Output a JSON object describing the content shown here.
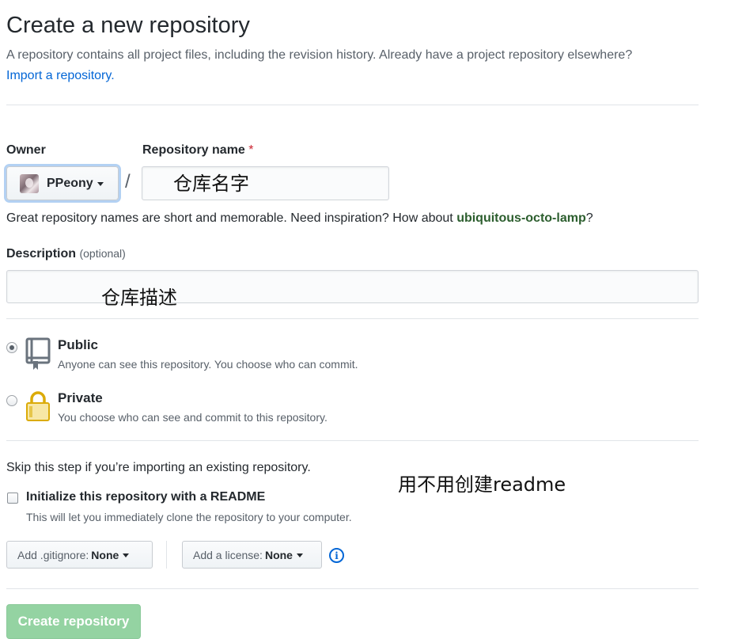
{
  "header": {
    "title": "Create a new repository",
    "subtitle": "A repository contains all project files, including the revision history. Already have a project repository elsewhere?",
    "import_link": "Import a repository."
  },
  "form": {
    "owner_label": "Owner",
    "owner_name": "PPeony",
    "slash": "/",
    "repo_name_label": "Repository name",
    "required_mark": "*",
    "repo_name_annotation": "仓库名字",
    "name_hint_prefix": "Great repository names are short and memorable. Need inspiration? How about ",
    "name_suggestion": "ubiquitous-octo-lamp",
    "name_hint_suffix": "?",
    "description_label": "Description",
    "description_optional": "(optional)",
    "description_annotation": "仓库描述"
  },
  "visibility": {
    "public": {
      "title": "Public",
      "description": "Anyone can see this repository. You choose who can commit.",
      "selected": true
    },
    "private": {
      "title": "Private",
      "description": "You choose who can see and commit to this repository.",
      "selected": false
    }
  },
  "init": {
    "skip_text": "Skip this step if you’re importing an existing repository.",
    "readme_annotation": "用不用创建readme",
    "readme_label": "Initialize this repository with a README",
    "readme_hint": "This will let you immediately clone the repository to your computer.",
    "readme_checked": false,
    "gitignore_label": "Add .gitignore:",
    "gitignore_value": "None",
    "license_label": "Add a license:",
    "license_value": "None",
    "info_glyph": "i"
  },
  "submit": {
    "create_label": "Create repository"
  },
  "icons": {
    "repo": "repo-book-icon",
    "lock": "lock-icon",
    "info": "info-icon",
    "caret": "caret-down-icon"
  },
  "colors": {
    "link": "#0366d6",
    "create_button": "#94d3a2",
    "required": "#cb2431",
    "suggestion": "#2c5e2e"
  }
}
